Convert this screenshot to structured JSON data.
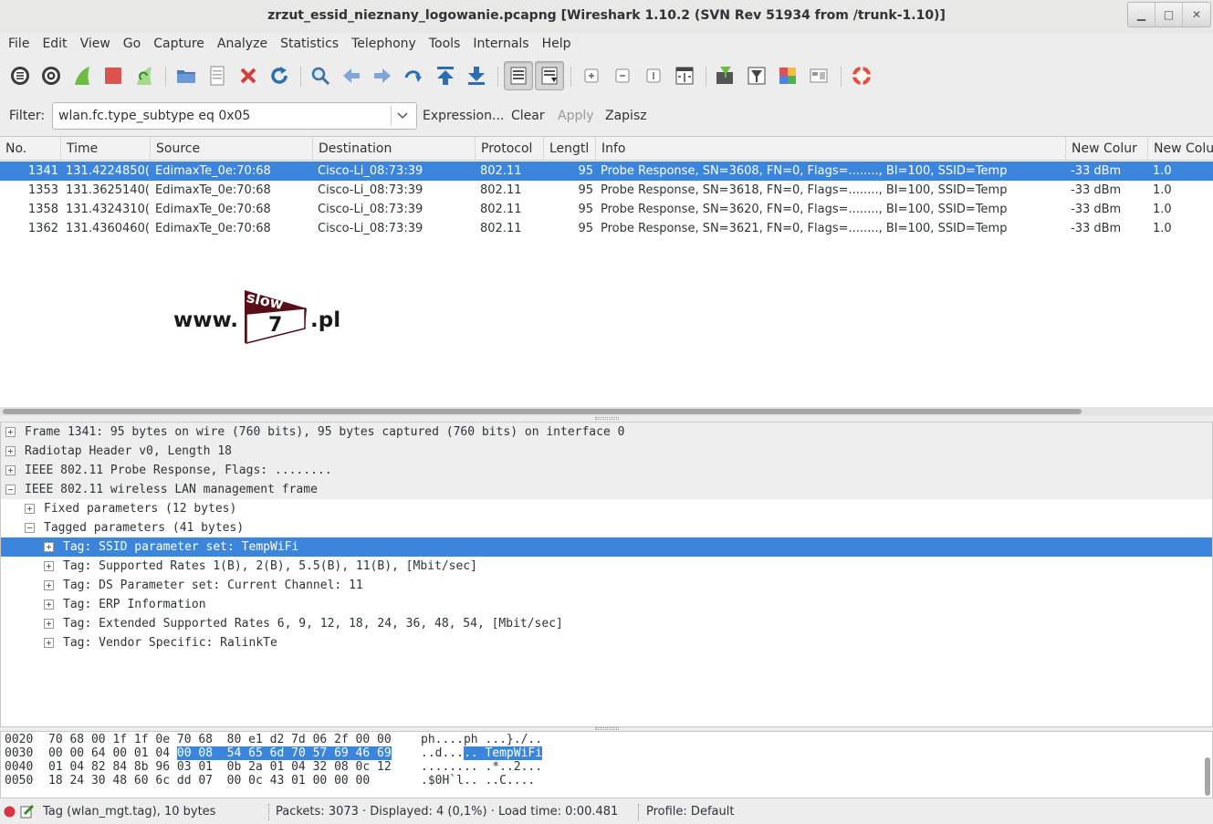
{
  "window": {
    "title": "zrzut_essid_nieznany_logowanie.pcapng  [Wireshark 1.10.2  (SVN Rev 51934 from /trunk-1.10)]",
    "buttons": [
      "minimize-icon",
      "maximize-icon",
      "close-icon"
    ]
  },
  "menu": [
    "File",
    "Edit",
    "View",
    "Go",
    "Capture",
    "Analyze",
    "Statistics",
    "Telephony",
    "Tools",
    "Internals",
    "Help"
  ],
  "toolbar": {
    "icons": [
      "interfaces-icon",
      "options-icon",
      "start-capture-icon",
      "stop-capture-icon",
      "restart-capture-icon",
      "open-file-icon",
      "save-file-icon",
      "close-file-icon",
      "reload-icon",
      "find-icon",
      "back-icon",
      "forward-icon",
      "goto-icon",
      "first-packet-icon",
      "last-packet-icon",
      "colorize-icon",
      "autoscroll-icon",
      "zoom-in-icon",
      "zoom-out-icon",
      "normal-size-icon",
      "resize-columns-icon",
      "capture-filters-icon",
      "display-filters-icon",
      "coloring-rules-icon",
      "preferences-icon",
      "help-icon"
    ]
  },
  "filter": {
    "label": "Filter:",
    "value": "wlan.fc.type_subtype eq 0x05",
    "expression": "Expression...",
    "clear": "Clear",
    "apply": "Apply",
    "save": "Zapisz"
  },
  "packet_list": {
    "columns": [
      "No.",
      "Time",
      "Source",
      "Destination",
      "Protocol",
      "Lengtl",
      "Info",
      "New Colur",
      "New Colu"
    ],
    "rows": [
      {
        "no": "1341",
        "time": "131.4224850(",
        "source": "EdimaxTe_0e:70:68",
        "destination": "Cisco-Li_08:73:39",
        "protocol": "802.11",
        "length": "95",
        "info": "Probe Response, SN=3608, FN=0, Flags=........, BI=100, SSID=Temp",
        "col1": "-33 dBm",
        "col2": "1.0",
        "selected": true
      },
      {
        "no": "1353",
        "time": "131.3625140(",
        "source": "EdimaxTe_0e:70:68",
        "destination": "Cisco-Li_08:73:39",
        "protocol": "802.11",
        "length": "95",
        "info": "Probe Response, SN=3618, FN=0, Flags=........, BI=100, SSID=Temp",
        "col1": "-33 dBm",
        "col2": "1.0",
        "selected": false
      },
      {
        "no": "1358",
        "time": "131.4324310(",
        "source": "EdimaxTe_0e:70:68",
        "destination": "Cisco-Li_08:73:39",
        "protocol": "802.11",
        "length": "95",
        "info": "Probe Response, SN=3620, FN=0, Flags=........, BI=100, SSID=Temp",
        "col1": "-33 dBm",
        "col2": "1.0",
        "selected": false
      },
      {
        "no": "1362",
        "time": "131.4360460(",
        "source": "EdimaxTe_0e:70:68",
        "destination": "Cisco-Li_08:73:39",
        "protocol": "802.11",
        "length": "95",
        "info": "Probe Response, SN=3621, FN=0, Flags=........, BI=100, SSID=Temp",
        "col1": "-33 dBm",
        "col2": "1.0",
        "selected": false
      }
    ]
  },
  "logo": {
    "prefix": "www.",
    "word": "slow",
    "digit": "7",
    "suffix": ".pl"
  },
  "details": [
    {
      "text": "Frame 1341: 95 bytes on wire (760 bits), 95 bytes captured (760 bits) on interface 0",
      "level": 0,
      "expanded": false
    },
    {
      "text": "Radiotap Header v0, Length 18",
      "level": 0,
      "expanded": false
    },
    {
      "text": "IEEE 802.11 Probe Response, Flags: ........",
      "level": 0,
      "expanded": false
    },
    {
      "text": "IEEE 802.11 wireless LAN management frame",
      "level": 0,
      "expanded": true
    },
    {
      "text": "Fixed parameters (12 bytes)",
      "level": 1,
      "expanded": false
    },
    {
      "text": "Tagged parameters (41 bytes)",
      "level": 1,
      "expanded": true
    },
    {
      "text": "Tag: SSID parameter set: TempWiFi",
      "level": 2,
      "expanded": false,
      "selected": true
    },
    {
      "text": "Tag: Supported Rates 1(B), 2(B), 5.5(B), 11(B), [Mbit/sec]",
      "level": 2,
      "expanded": false
    },
    {
      "text": "Tag: DS Parameter set: Current Channel: 11",
      "level": 2,
      "expanded": false
    },
    {
      "text": "Tag: ERP Information",
      "level": 2,
      "expanded": false
    },
    {
      "text": "Tag: Extended Supported Rates 6, 9, 12, 18, 24, 36, 48, 54, [Mbit/sec]",
      "level": 2,
      "expanded": false
    },
    {
      "text": "Tag: Vendor Specific: RalinkTe",
      "level": 2,
      "expanded": false
    }
  ],
  "hex": [
    {
      "offset": "0020",
      "bytes_pre": "70 68 00 1f 1f 0e 70 68  80 e1 d2 7d 06 2f 00 00",
      "bytes_hl": "",
      "bytes_post": "",
      "ascii_pre": "ph....ph ...}./..",
      "ascii_hl": "",
      "ascii_post": ""
    },
    {
      "offset": "0030",
      "bytes_pre": "00 00 64 00 01 04 ",
      "bytes_hl": "00 08  54 65 6d 70 57 69 46 69",
      "bytes_post": "",
      "ascii_pre": "..d...",
      "ascii_hl": ".. TempWiFi",
      "ascii_post": ""
    },
    {
      "offset": "0040",
      "bytes_pre": "01 04 82 84 8b 96 03 01  0b 2a 01 04 32 08 0c 12",
      "bytes_hl": "",
      "bytes_post": "",
      "ascii_pre": "........ .*..2...",
      "ascii_hl": "",
      "ascii_post": ""
    },
    {
      "offset": "0050",
      "bytes_pre": "18 24 30 48 60 6c dd 07  00 0c 43 01 00 00 00",
      "bytes_hl": "",
      "bytes_post": "",
      "ascii_pre": ".$0H`l.. ..C....",
      "ascii_hl": "",
      "ascii_post": ""
    }
  ],
  "status": {
    "field": "Tag (wlan_mgt.tag), 10 bytes",
    "packets": "Packets: 3073 · Displayed: 4 (0,1%) · Load time: 0:00.481",
    "profile": "Profile: Default"
  },
  "colors": {
    "selection": "#3b86dc",
    "stop": "#d9534f",
    "shark_fin": "#6dbd45"
  }
}
